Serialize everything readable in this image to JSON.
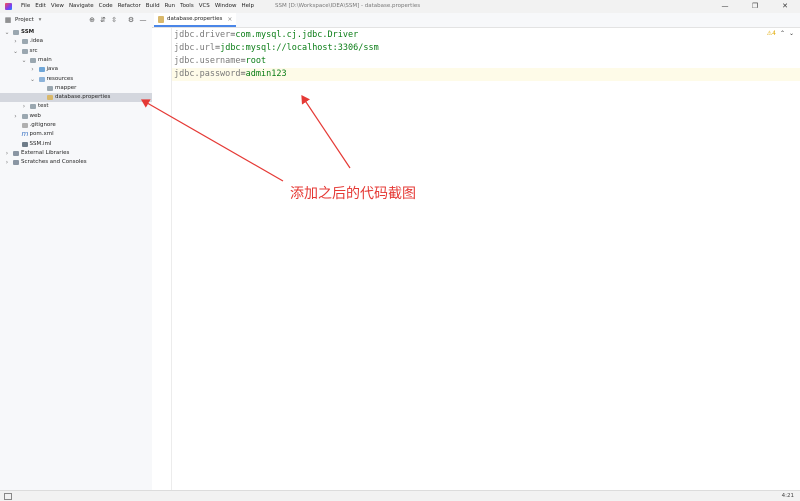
{
  "window": {
    "title": "SSM [D:\\Workspace\\IDEA\\SSM] - database.properties",
    "menu": [
      "File",
      "Edit",
      "View",
      "Navigate",
      "Code",
      "Refactor",
      "Build",
      "Run",
      "Tools",
      "VCS",
      "Window",
      "Help"
    ]
  },
  "project_panel": {
    "label": "Project",
    "tree": [
      {
        "label": "SSM",
        "indent": 0,
        "expanded": true,
        "icon": "folder-icon"
      },
      {
        "label": ".idea",
        "indent": 1,
        "expanded": false,
        "icon": "folder-icon"
      },
      {
        "label": "src",
        "indent": 1,
        "expanded": true,
        "icon": "folder-icon"
      },
      {
        "label": "main",
        "indent": 2,
        "expanded": true,
        "icon": "folder-icon"
      },
      {
        "label": "java",
        "indent": 3,
        "expanded": false,
        "icon": "source-folder-icon"
      },
      {
        "label": "resources",
        "indent": 3,
        "expanded": true,
        "icon": "resources-folder-icon"
      },
      {
        "label": "mapper",
        "indent": 4,
        "expanded": null,
        "icon": "folder-icon"
      },
      {
        "label": "database.properties",
        "indent": 4,
        "expanded": null,
        "icon": "properties-file-icon",
        "selected": true
      },
      {
        "label": "test",
        "indent": 2,
        "expanded": false,
        "icon": "folder-icon"
      },
      {
        "label": "web",
        "indent": 1,
        "expanded": false,
        "icon": "folder-icon"
      },
      {
        "label": ".gitignore",
        "indent": 1,
        "expanded": null,
        "icon": "gitignore-file-icon"
      },
      {
        "label": "pom.xml",
        "indent": 1,
        "expanded": null,
        "icon": "maven-file-icon"
      },
      {
        "label": "SSM.iml",
        "indent": 1,
        "expanded": null,
        "icon": "iml-file-icon"
      },
      {
        "label": "External Libraries",
        "indent": 0,
        "expanded": false,
        "icon": "library-icon"
      },
      {
        "label": "Scratches and Consoles",
        "indent": 0,
        "expanded": false,
        "icon": "scratches-icon"
      }
    ]
  },
  "editor": {
    "tab_label": "database.properties",
    "lines": [
      {
        "key": "jdbc.driver",
        "value": "com.mysql.cj.jdbc.Driver"
      },
      {
        "key": "jdbc.url",
        "value": "jdbc:mysql://localhost:3306/ssm"
      },
      {
        "key": "jdbc.username",
        "value": "root"
      },
      {
        "key": "jdbc.password",
        "value": "admin123"
      }
    ],
    "current_line_index": 3,
    "warning_count": "4"
  },
  "annotation": {
    "text": "添加之后的代码截图",
    "color": "#e53935"
  },
  "statusbar": {
    "position": "4:21"
  }
}
